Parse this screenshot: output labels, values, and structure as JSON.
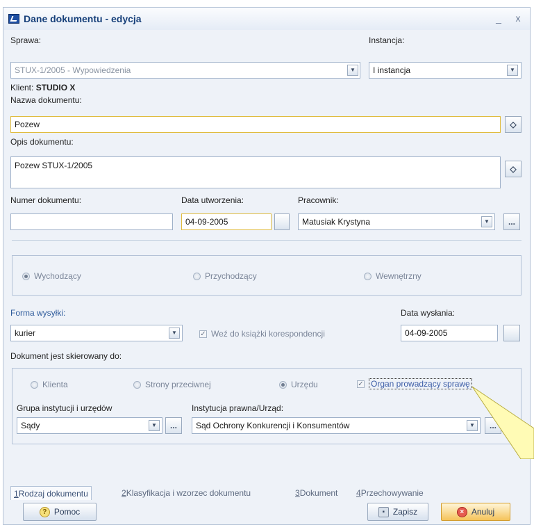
{
  "window": {
    "title": "Dane dokumentu - edycja",
    "minimize_label": "_",
    "close_label": "x"
  },
  "sprawa": {
    "label": "Sprawa:",
    "value": "STUX-1/2005 - Wypowiedzenia"
  },
  "instancja": {
    "label": "Instancja:",
    "value": "I instancja"
  },
  "klient": {
    "label": "Klient:",
    "value": "STUDIO X"
  },
  "nazwa": {
    "label": "Nazwa dokumentu:",
    "value": "Pozew"
  },
  "opis": {
    "label": "Opis dokumentu:",
    "value": "Pozew  STUX-1/2005"
  },
  "numer": {
    "label": "Numer dokumentu:",
    "value": ""
  },
  "data_utworzenia": {
    "label": "Data utworzenia:",
    "value": "04-09-2005"
  },
  "pracownik": {
    "label": "Pracownik:",
    "value": "Matusiak Krystyna"
  },
  "ellipsis": "...",
  "direction": {
    "options": [
      {
        "label": "Wychodzący",
        "selected": true
      },
      {
        "label": "Przychodzący",
        "selected": false
      },
      {
        "label": "Wewnętrzny",
        "selected": false
      }
    ]
  },
  "forma_wysylki": {
    "label": "Forma wysyłki:",
    "value": "kurier"
  },
  "wez_checkbox": {
    "label": "Weź do książki korespondencji",
    "checked": true
  },
  "data_wyslania": {
    "label": "Data wysłania:",
    "value": "04-09-2005"
  },
  "skierowany": {
    "label": "Dokument jest skierowany do:",
    "options": [
      {
        "label": "Klienta",
        "selected": false
      },
      {
        "label": "Strony przeciwnej",
        "selected": false
      },
      {
        "label": "Urzędu",
        "selected": true
      }
    ]
  },
  "organ_checkbox": {
    "label": "Organ prowadzący sprawę",
    "checked": true
  },
  "grupa": {
    "label": "Grupa instytucji i urzędów",
    "value": "Sądy"
  },
  "instytucja": {
    "label": "Instytucja prawna/Urząd:",
    "value": "Sąd Ochrony Konkurencji i Konsumentów"
  },
  "tabs": [
    {
      "key": "1",
      "label": "Rodzaj dokumentu",
      "active": true
    },
    {
      "key": "2",
      "label": "Klasyfikacja i wzorzec dokumentu",
      "active": false
    },
    {
      "key": "3",
      "label": "Dokument",
      "active": false
    },
    {
      "key": "4",
      "label": "Przechowywanie",
      "active": false
    }
  ],
  "buttons": {
    "help": "Pomoc",
    "save": "Zapisz",
    "cancel": "Anuluj"
  },
  "colors": {
    "accent": "#1d4ea2",
    "field_highlight": "#e0bc3e",
    "tooltip_callout": "#fffbb5"
  }
}
